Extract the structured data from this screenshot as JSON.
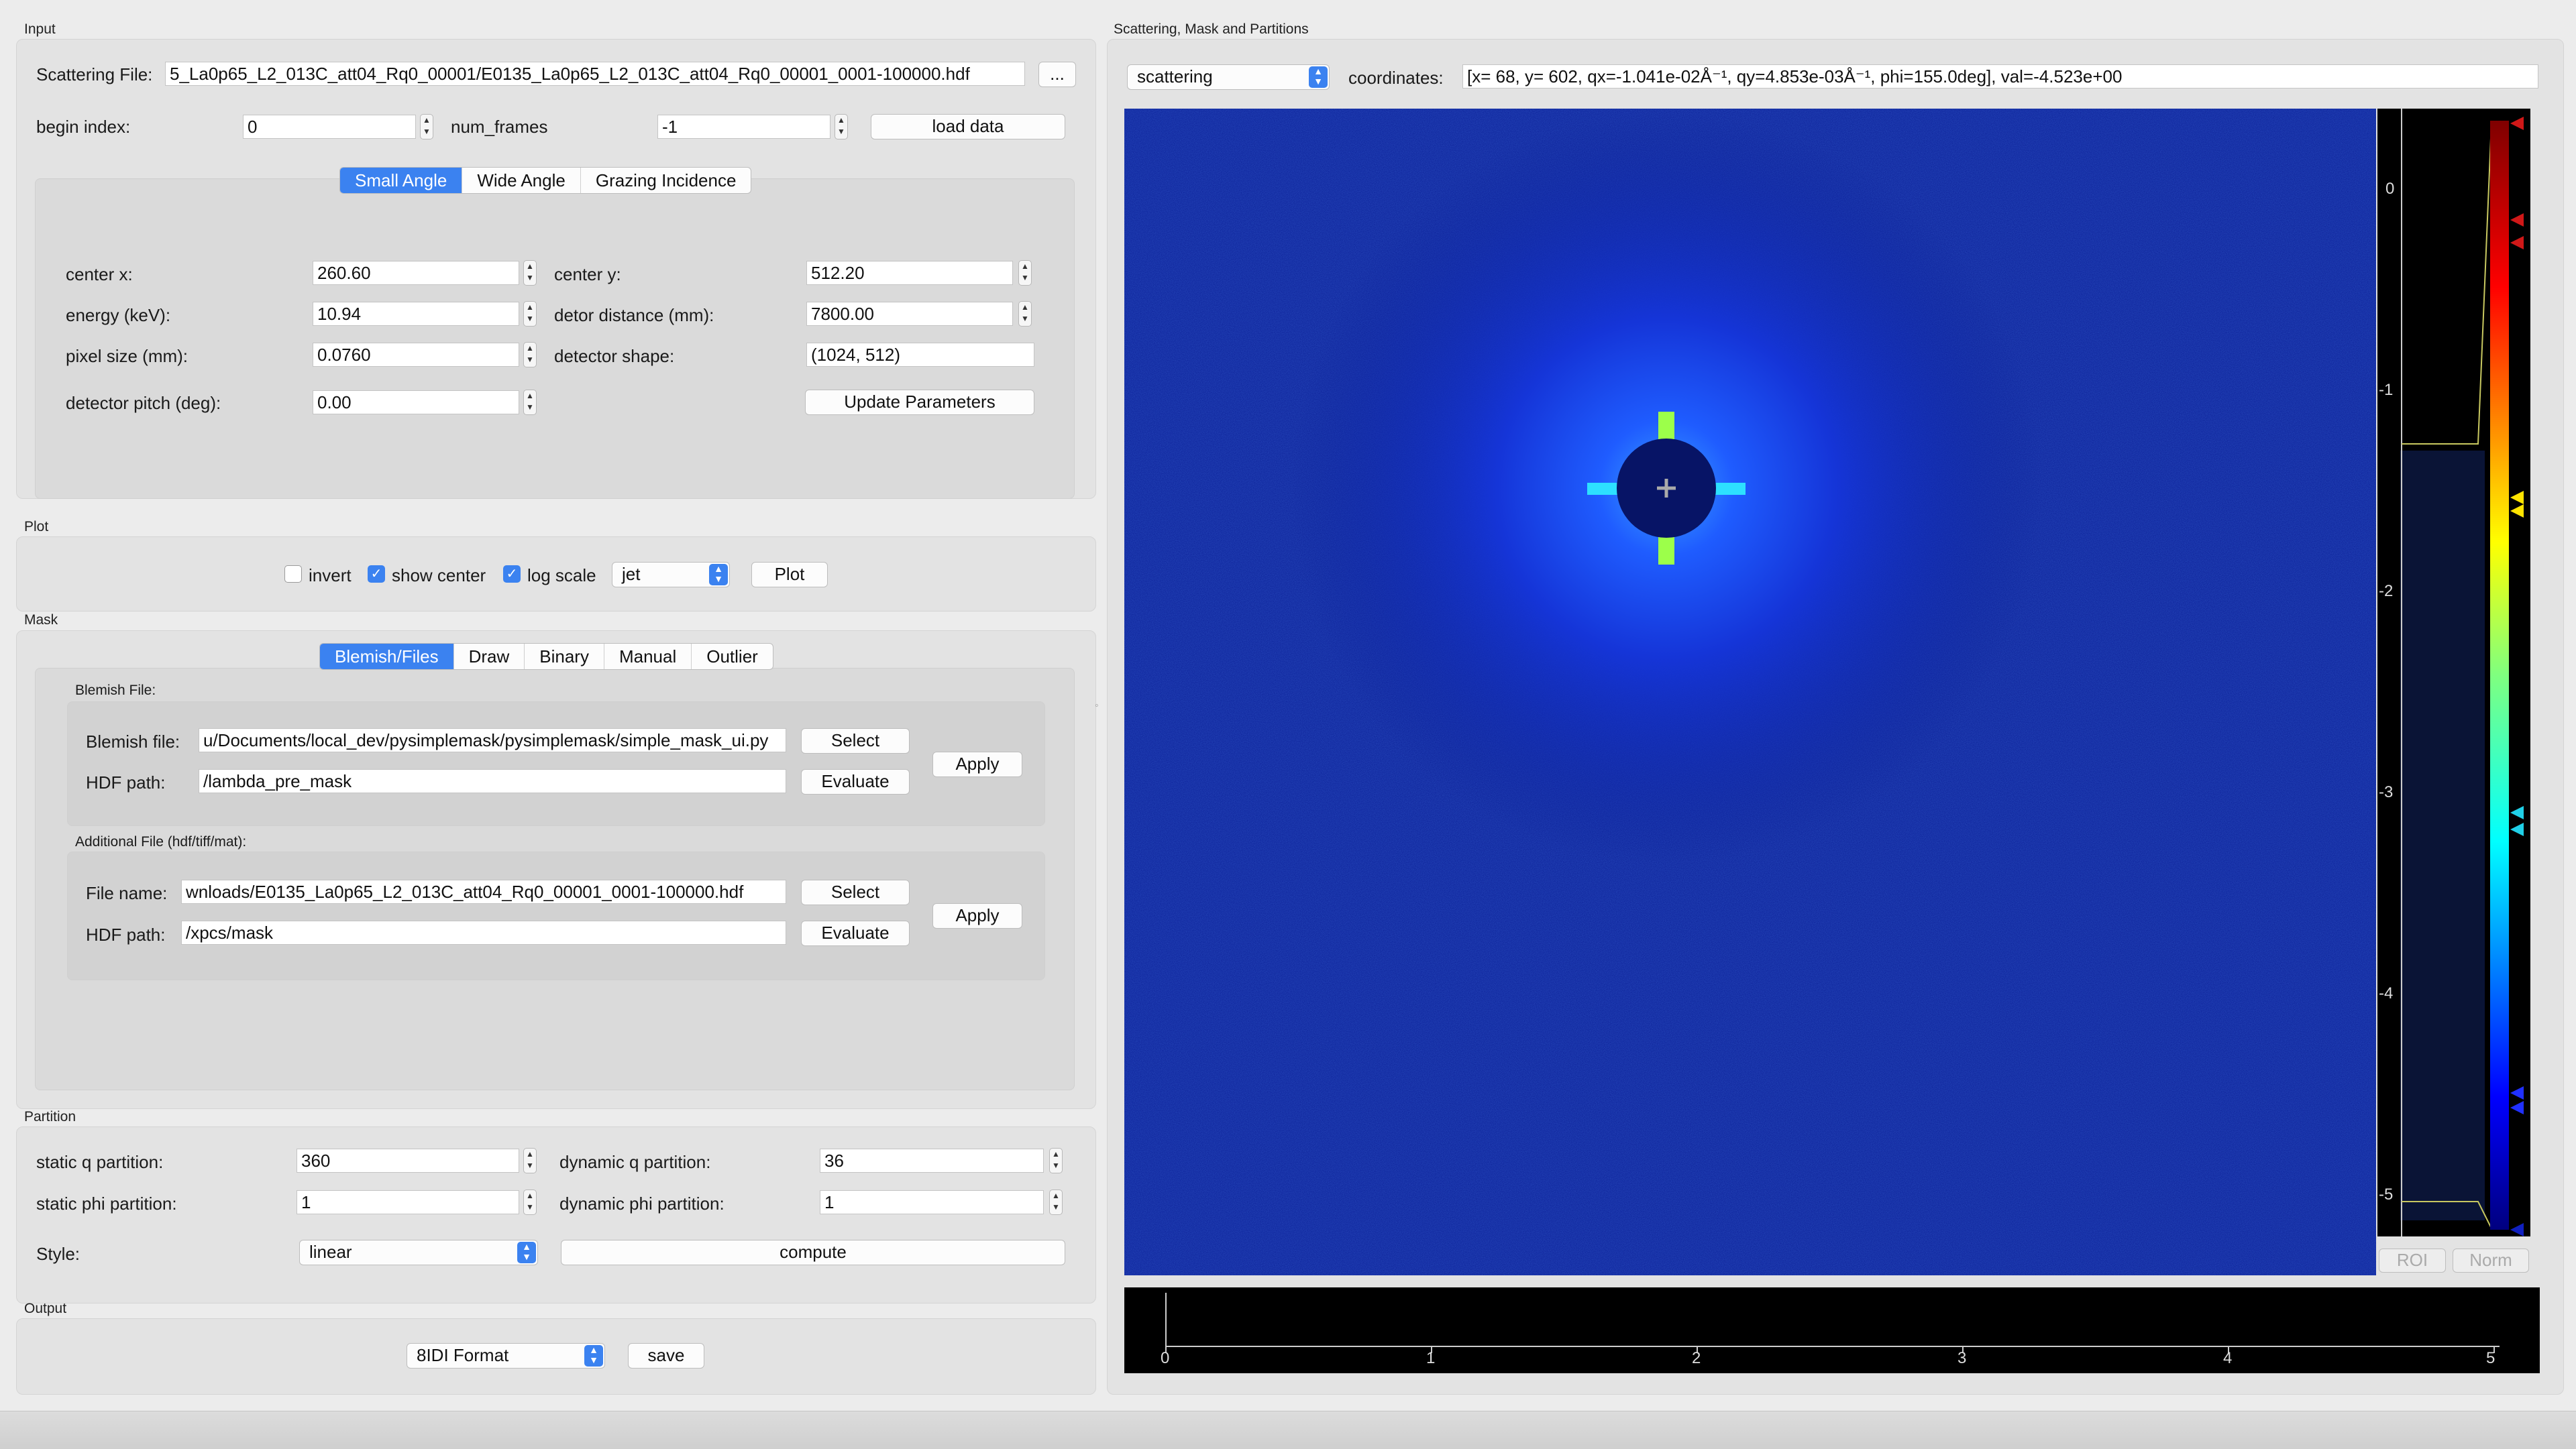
{
  "input": {
    "section_title": "Input",
    "scattering_file_label": "Scattering File:",
    "scattering_file_value": "5_La0p65_L2_013C_att04_Rq0_00001/E0135_La0p65_L2_013C_att04_Rq0_00001_0001-100000.hdf",
    "browse_label": "...",
    "begin_index_label": "begin index:",
    "begin_index_value": "0",
    "num_frames_label": "num_frames",
    "num_frames_value": "-1",
    "load_data_label": "load data",
    "tabs": [
      "Small Angle",
      "Wide Angle",
      "Grazing Incidence"
    ],
    "center_x_label": "center x:",
    "center_x_value": "260.60",
    "center_y_label": "center y:",
    "center_y_value": "512.20",
    "energy_label": "energy (keV):",
    "energy_value": "10.94",
    "detor_distance_label": "detor distance (mm):",
    "detor_distance_value": "7800.00",
    "pixel_size_label": "pixel size (mm):",
    "pixel_size_value": "0.0760",
    "detector_shape_label": "detector shape:",
    "detector_shape_value": "(1024, 512)",
    "detector_pitch_label": "detector pitch (deg):",
    "detector_pitch_value": "0.00",
    "update_params_label": "Update Parameters"
  },
  "plot": {
    "section_title": "Plot",
    "invert_label": "invert",
    "show_center_label": "show center",
    "log_scale_label": "log scale",
    "colormap_value": "jet",
    "plot_button": "Plot"
  },
  "mask": {
    "section_title": "Mask",
    "tabs": [
      "Blemish/Files",
      "Draw",
      "Binary",
      "Manual",
      "Outlier"
    ],
    "blemish_group_title": "Blemish File:",
    "blemish_file_label": "Blemish file:",
    "blemish_file_value": "u/Documents/local_dev/pysimplemask/pysimplemask/simple_mask_ui.py",
    "blemish_hdf_label": "HDF path:",
    "blemish_hdf_value": "/lambda_pre_mask",
    "select_label": "Select",
    "evaluate_label": "Evaluate",
    "apply_label": "Apply",
    "additional_group_title": "Additional File (hdf/tiff/mat):",
    "file_name_label": "File name:",
    "file_name_value": "wnloads/E0135_La0p65_L2_013C_att04_Rq0_00001_0001-100000.hdf",
    "additional_hdf_label": "HDF path:",
    "additional_hdf_value": "/xpcs/mask"
  },
  "partition": {
    "section_title": "Partition",
    "static_q_label": "static q partition:",
    "static_q_value": "360",
    "dynamic_q_label": "dynamic q partition:",
    "dynamic_q_value": "36",
    "static_phi_label": "static phi partition:",
    "static_phi_value": "1",
    "dynamic_phi_label": "dynamic phi partition:",
    "dynamic_phi_value": "1",
    "style_label": "Style:",
    "style_value": "linear",
    "compute_label": "compute"
  },
  "output": {
    "section_title": "Output",
    "format_value": "8IDI Format",
    "save_label": "save"
  },
  "viewer": {
    "section_title": "Scattering, Mask and Partitions",
    "view_select_value": "scattering",
    "coordinates_label": "coordinates:",
    "coordinates_value": "[x=  68, y= 602, qx=-1.041e-02Å⁻¹, qy=4.853e-03Å⁻¹, phi=155.0deg], val=-4.523e+00",
    "colorbar_ticks": [
      "0",
      "-1",
      "-2",
      "-3",
      "-4",
      "-5"
    ],
    "roi_label": "ROI",
    "norm_label": "Norm",
    "timeline_ticks": [
      "0",
      "1",
      "2",
      "3",
      "4",
      "5"
    ]
  },
  "colors": {
    "accent": "#3b82f0",
    "image_bg": "#0a1e96",
    "panel_bg": "#e3e3e3"
  }
}
